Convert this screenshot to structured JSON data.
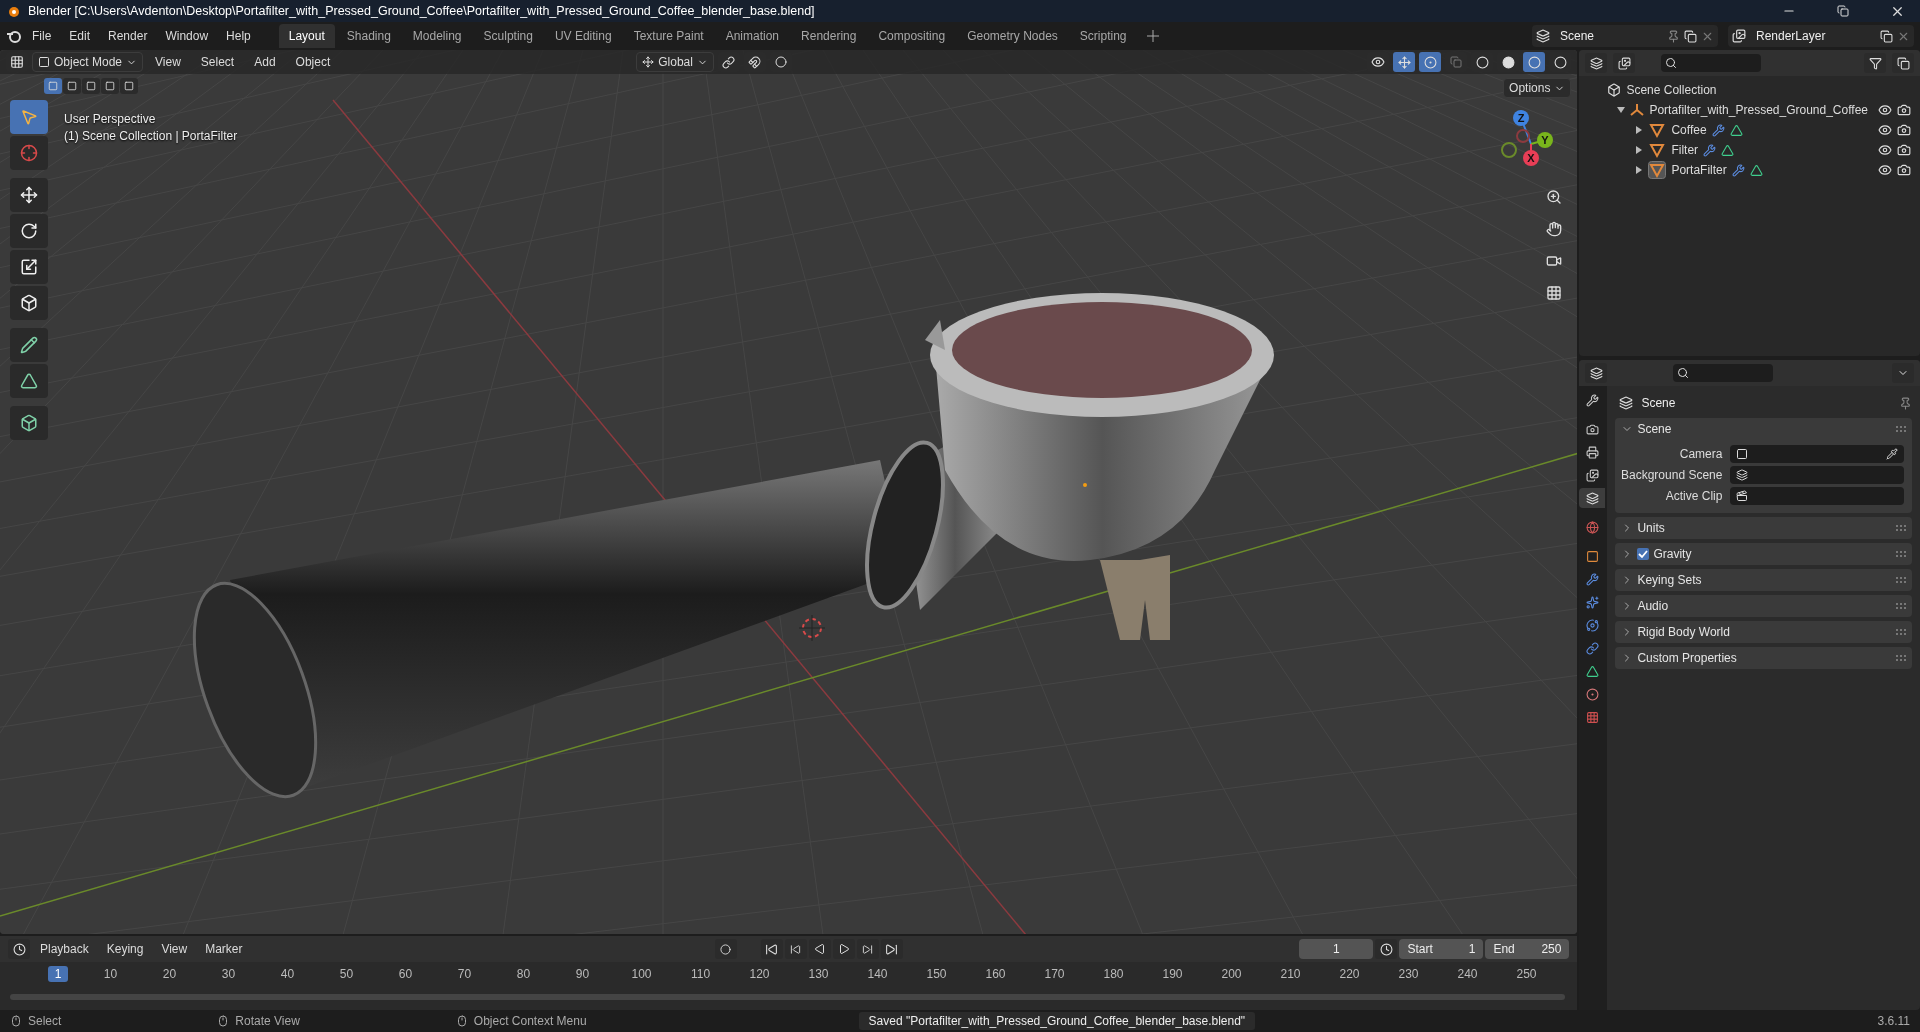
{
  "window": {
    "title": "Blender [C:\\Users\\Avdenton\\Desktop\\Portafilter_with_Pressed_Ground_Coffee\\Portafilter_with_Pressed_Ground_Coffee_blender_base.blend]"
  },
  "menu": [
    "File",
    "Edit",
    "Render",
    "Window",
    "Help"
  ],
  "workspaces": [
    {
      "label": "Layout",
      "selected": true
    },
    {
      "label": "Shading",
      "selected": false
    },
    {
      "label": "Modeling",
      "selected": false
    },
    {
      "label": "Sculpting",
      "selected": false
    },
    {
      "label": "UV Editing",
      "selected": false
    },
    {
      "label": "Texture Paint",
      "selected": false
    },
    {
      "label": "Animation",
      "selected": false
    },
    {
      "label": "Rendering",
      "selected": false
    },
    {
      "label": "Compositing",
      "selected": false
    },
    {
      "label": "Geometry Nodes",
      "selected": false
    },
    {
      "label": "Scripting",
      "selected": false
    }
  ],
  "scene": {
    "name": "Scene",
    "view_layer": "RenderLayer"
  },
  "viewport": {
    "mode": "Object Mode",
    "menus": [
      "View",
      "Select",
      "Add",
      "Object"
    ],
    "orientation": "Global",
    "options": "Options",
    "info": [
      "User Perspective",
      "(1) Scene Collection | PortaFilter"
    ],
    "shading": [
      {
        "kind": "wireframe",
        "selected": false
      },
      {
        "kind": "solid",
        "selected": false
      },
      {
        "kind": "material",
        "selected": true
      },
      {
        "kind": "rendered",
        "selected": false
      }
    ],
    "gizmo": [
      {
        "axis": "Z",
        "kind": "z"
      },
      {
        "axis": "Y",
        "kind": "y"
      },
      {
        "axis": "X",
        "kind": "x"
      }
    ]
  },
  "tools": [
    {
      "kind": "select",
      "selected": true
    },
    {
      "kind": "cursor",
      "selected": false
    },
    {
      "kind": "move",
      "selected": false
    },
    {
      "kind": "rotate",
      "selected": false
    },
    {
      "kind": "scale",
      "selected": false
    },
    {
      "kind": "transform",
      "selected": false
    },
    {
      "kind": "annotate",
      "selected": false
    },
    {
      "kind": "measure",
      "selected": false
    },
    {
      "kind": "add_cube",
      "selected": false
    }
  ],
  "outliner": {
    "root": "Scene Collection",
    "items": [
      {
        "label": "Portafilter_with_Pressed_Ground_Coffee",
        "kind": "empty",
        "expanded": true,
        "children": [
          {
            "label": "Coffee",
            "kind": "mesh",
            "expanded": false,
            "active": false
          },
          {
            "label": "Filter",
            "kind": "mesh",
            "expanded": false,
            "active": false
          },
          {
            "label": "PortaFilter",
            "kind": "mesh",
            "expanded": false,
            "active": true
          }
        ]
      }
    ]
  },
  "properties": {
    "title": "Scene",
    "tabs": [
      {
        "kind": "tool",
        "selected": false
      },
      {
        "kind": "render",
        "selected": false
      },
      {
        "kind": "output",
        "selected": false
      },
      {
        "kind": "view_layer",
        "selected": false
      },
      {
        "kind": "scene",
        "selected": true
      },
      {
        "kind": "world",
        "selected": false
      },
      {
        "kind": "object",
        "selected": false
      },
      {
        "kind": "modifier",
        "selected": false
      },
      {
        "kind": "particles",
        "selected": false
      },
      {
        "kind": "physics",
        "selected": false
      },
      {
        "kind": "constraints",
        "selected": false
      },
      {
        "kind": "data",
        "selected": false
      },
      {
        "kind": "material",
        "selected": false
      },
      {
        "kind": "texture",
        "selected": false
      }
    ],
    "panels": [
      {
        "title": "Scene",
        "expanded": true,
        "fields": [
          {
            "label": "Camera",
            "kind": "camera"
          },
          {
            "label": "Background Scene",
            "kind": "scene"
          },
          {
            "label": "Active Clip",
            "kind": "clip"
          }
        ]
      },
      {
        "title": "Units",
        "expanded": false
      },
      {
        "title": "Gravity",
        "expanded": false,
        "checked": true
      },
      {
        "title": "Keying Sets",
        "expanded": false
      },
      {
        "title": "Audio",
        "expanded": false
      },
      {
        "title": "Rigid Body World",
        "expanded": false
      },
      {
        "title": "Custom Properties",
        "expanded": false
      }
    ]
  },
  "timeline": {
    "menus": [
      "Playback",
      "Keying",
      "View",
      "Marker"
    ],
    "frame": "1",
    "start_label": "Start",
    "start": "1",
    "end_label": "End",
    "end": "250",
    "current": "1",
    "ticks": [
      "10",
      "20",
      "30",
      "40",
      "50",
      "60",
      "70",
      "80",
      "90",
      "100",
      "110",
      "120",
      "130",
      "140",
      "150",
      "160",
      "170",
      "180",
      "190",
      "200",
      "210",
      "220",
      "230",
      "240",
      "250"
    ]
  },
  "status_bar": {
    "hints": [
      "Select",
      "Rotate View",
      "Object Context Menu"
    ],
    "message": "Saved \"Portafilter_with_Pressed_Ground_Coffee_blender_base.blend\"",
    "version": "3.6.11"
  }
}
